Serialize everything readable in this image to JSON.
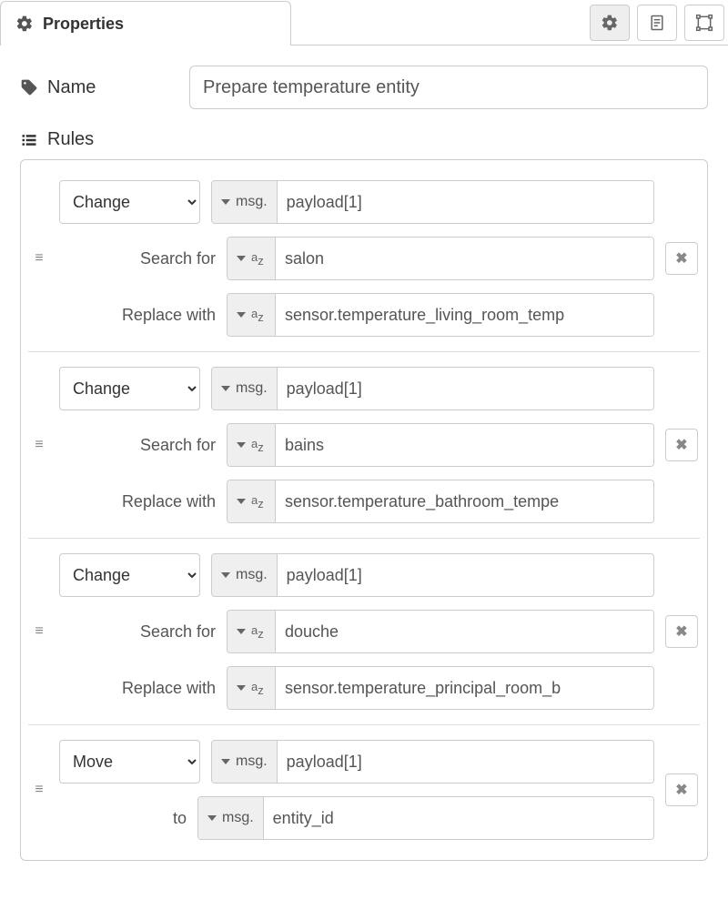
{
  "header": {
    "title": "Properties"
  },
  "name": {
    "label": "Name",
    "value": "Prepare temperature entity"
  },
  "rules_label": "Rules",
  "type_labels": {
    "msg": "msg.",
    "str": "az"
  },
  "labels": {
    "search_for": "Search for",
    "replace_with": "Replace with",
    "to": "to"
  },
  "rules": [
    {
      "action": "Change",
      "target_type": "msg",
      "target": "payload[1]",
      "search_type": "str",
      "search": "salon",
      "replace_type": "str",
      "replace": "sensor.temperature_living_room_temp"
    },
    {
      "action": "Change",
      "target_type": "msg",
      "target": "payload[1]",
      "search_type": "str",
      "search": "bains",
      "replace_type": "str",
      "replace": "sensor.temperature_bathroom_tempe"
    },
    {
      "action": "Change",
      "target_type": "msg",
      "target": "payload[1]",
      "search_type": "str",
      "search": "douche",
      "replace_type": "str",
      "replace": "sensor.temperature_principal_room_b"
    },
    {
      "action": "Move",
      "target_type": "msg",
      "target": "payload[1]",
      "to_type": "msg",
      "to": "entity_id"
    }
  ]
}
